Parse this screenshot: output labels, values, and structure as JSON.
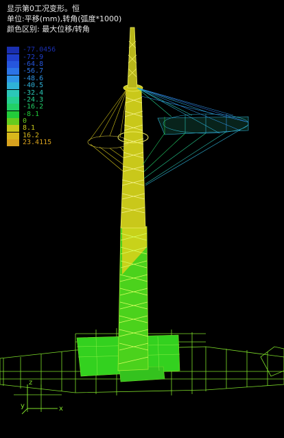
{
  "header": {
    "line1": "显示第0工况变形。恒",
    "line2": "单位:平移(mm),转角(弧度*1000)",
    "line3": "颜色区别: 最大位移/转角"
  },
  "legend": [
    {
      "label": "-77.0456",
      "color": "#1a2fb0"
    },
    {
      "label": "-72.9",
      "color": "#1f3fcc"
    },
    {
      "label": "-64.8",
      "color": "#2656dd"
    },
    {
      "label": "-56.7",
      "color": "#2c74e6"
    },
    {
      "label": "-48.6",
      "color": "#2f95e6"
    },
    {
      "label": "-40.5",
      "color": "#2fb2d8"
    },
    {
      "label": "-32.4",
      "color": "#2bc7b8"
    },
    {
      "label": "-24.3",
      "color": "#25cf90"
    },
    {
      "label": "-16.2",
      "color": "#22d066"
    },
    {
      "label": "-8.1",
      "color": "#22cc3a"
    },
    {
      "label": "0",
      "color": "#66cc1e"
    },
    {
      "label": "8.1",
      "color": "#c9c81a"
    },
    {
      "label": "16.2",
      "color": "#d8b81c"
    },
    {
      "label": "23.4115",
      "color": "#d8a21e"
    }
  ],
  "axis": {
    "x": "x",
    "y": "y",
    "z": "z"
  }
}
